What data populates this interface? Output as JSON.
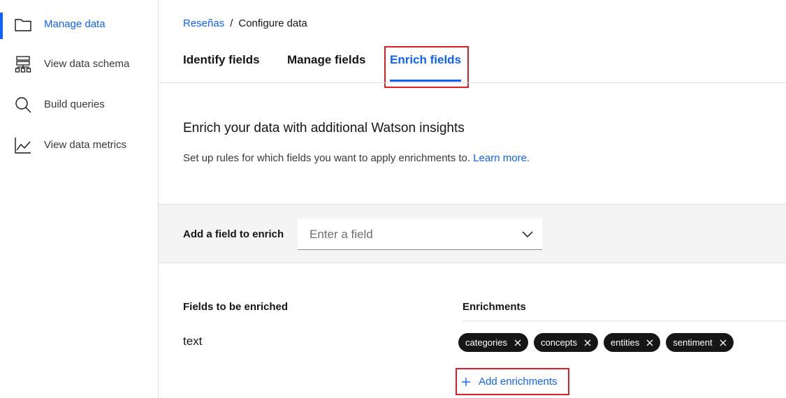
{
  "sidebar": {
    "items": [
      {
        "label": "Manage data",
        "icon": "folder-icon",
        "active": true
      },
      {
        "label": "View data schema",
        "icon": "schema-tree-icon",
        "active": false
      },
      {
        "label": "Build queries",
        "icon": "search-icon",
        "active": false
      },
      {
        "label": "View data metrics",
        "icon": "line-chart-icon",
        "active": false
      }
    ]
  },
  "breadcrumb": {
    "parent": "Reseñas",
    "separator": "/",
    "current": "Configure data"
  },
  "tabs": [
    {
      "label": "Identify fields",
      "active": false
    },
    {
      "label": "Manage fields",
      "active": false
    },
    {
      "label": "Enrich fields",
      "active": true
    }
  ],
  "intro": {
    "heading": "Enrich your data with additional Watson insights",
    "text": "Set up rules for which fields you want to apply enrichments to.",
    "link": "Learn more."
  },
  "field_picker": {
    "label": "Add a field to enrich",
    "placeholder": "Enter a field"
  },
  "table": {
    "col_field": "Fields to be enriched",
    "col_enrichments": "Enrichments",
    "rows": [
      {
        "field": "text",
        "enrichments": [
          "categories",
          "concepts",
          "entities",
          "sentiment"
        ]
      }
    ]
  },
  "add_enrichments_label": "Add enrichments",
  "colors": {
    "accent": "#0f62fe",
    "highlight": "#da1e28",
    "tag_bg": "#161616"
  }
}
